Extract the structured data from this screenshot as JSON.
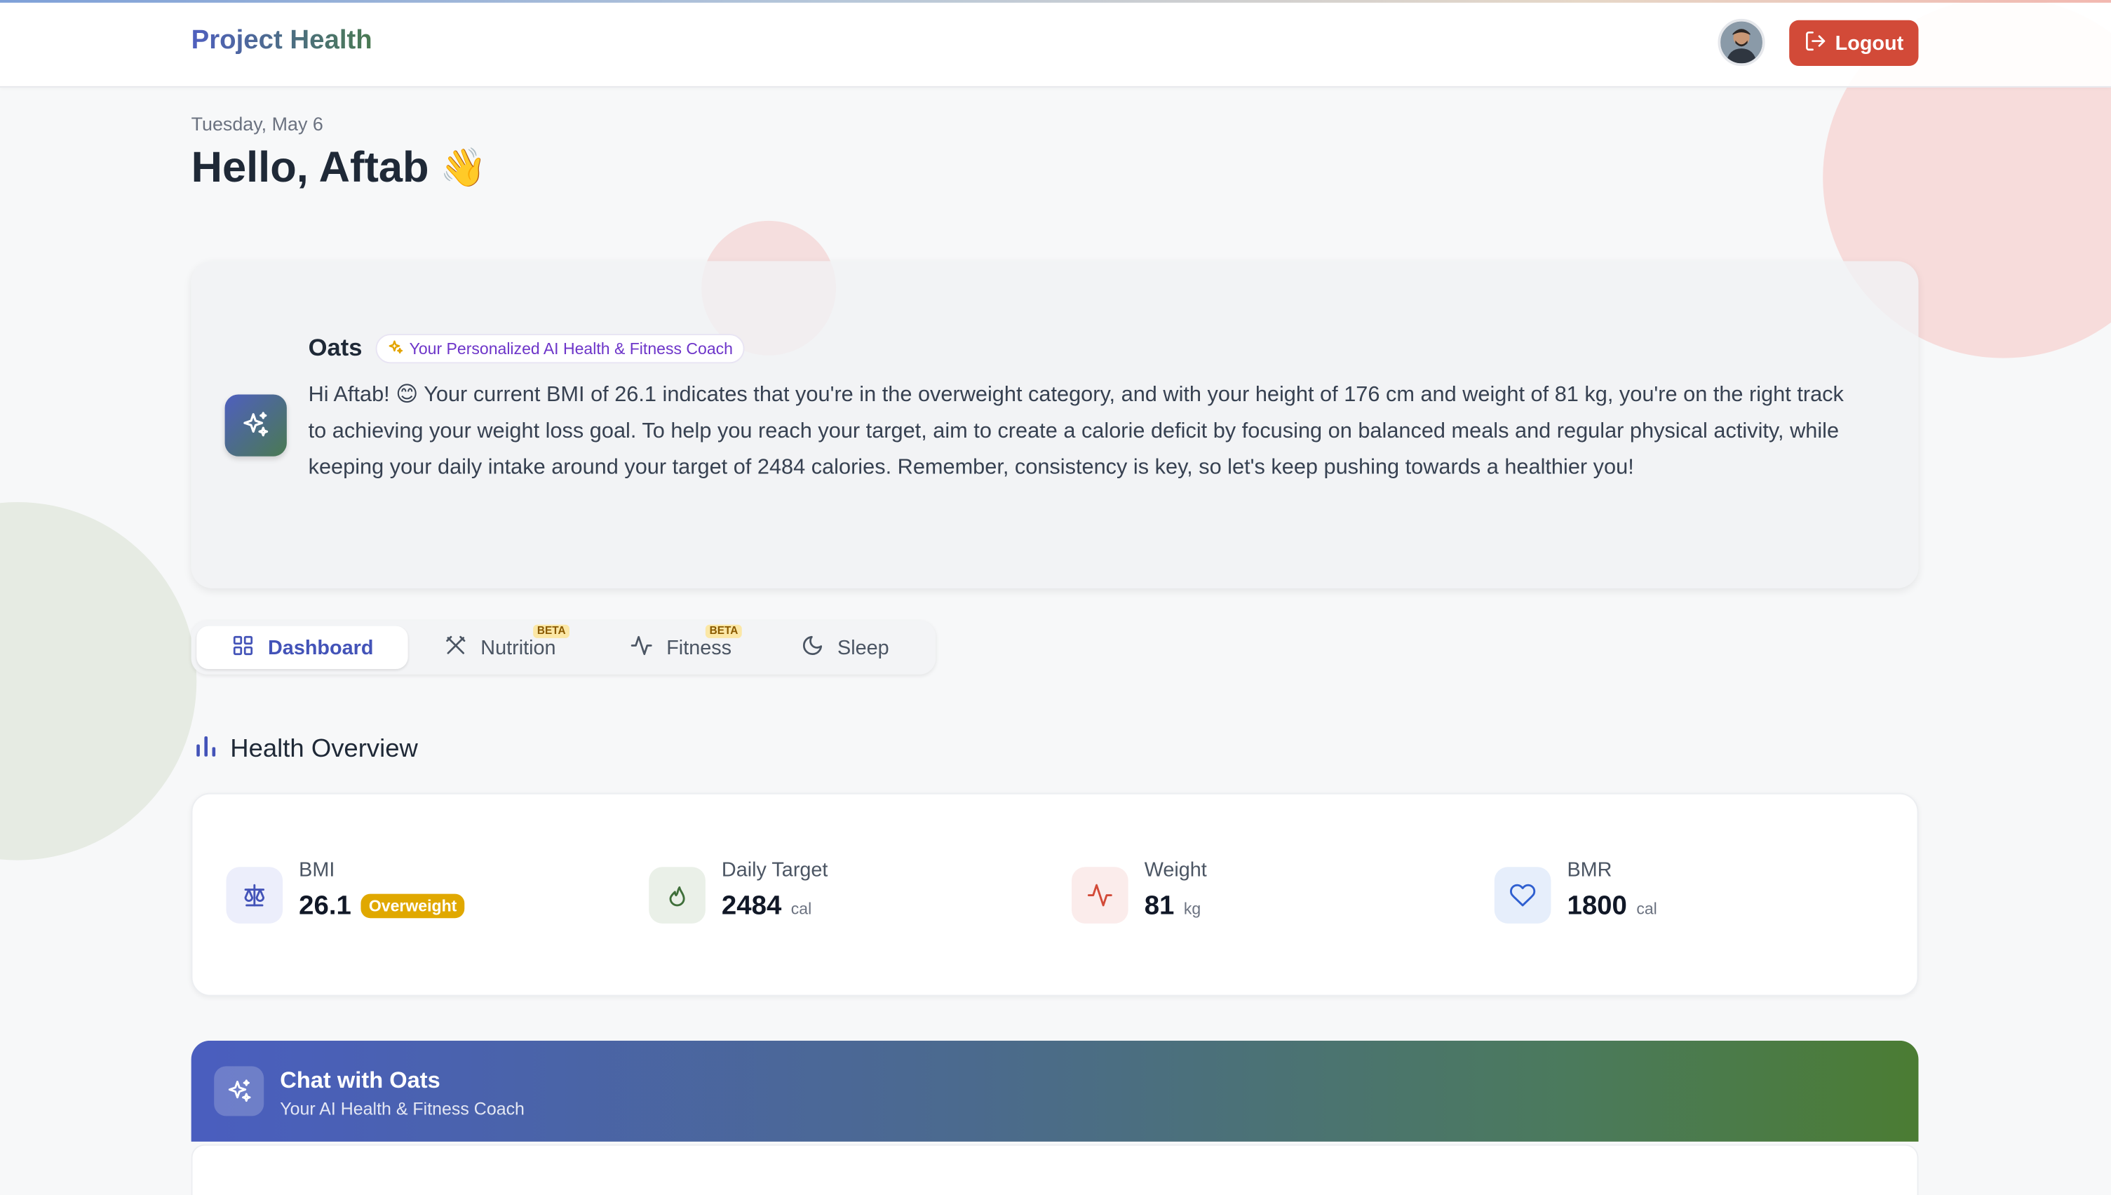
{
  "header": {
    "brand": "Project Health",
    "logout_label": "Logout",
    "avatar_alt": "User avatar"
  },
  "greeting": {
    "date": "Tuesday, May 6",
    "hello": "Hello, Aftab",
    "wave_emoji": "👋"
  },
  "oats": {
    "name": "Oats",
    "pill_label": "Your Personalized AI Health & Fitness Coach",
    "message": "Hi Aftab! 😊 Your current BMI of 26.1 indicates that you're in the overweight category, and with your height of 176 cm and weight of 81 kg, you're on the right track to achieving your weight loss goal. To help you reach your target, aim to create a calorie deficit by focusing on balanced meals and regular physical activity, while keeping your daily intake around your target of 2484 calories. Remember, consistency is key, so let's keep pushing towards a healthier you!"
  },
  "tabs": [
    {
      "label": "Dashboard",
      "icon": "grid-icon",
      "active": true,
      "beta": false
    },
    {
      "label": "Nutrition",
      "icon": "utensils-icon",
      "active": false,
      "beta": true,
      "beta_label": "BETA"
    },
    {
      "label": "Fitness",
      "icon": "activity-icon",
      "active": false,
      "beta": true,
      "beta_label": "BETA"
    },
    {
      "label": "Sleep",
      "icon": "moon-icon",
      "active": false,
      "beta": false
    }
  ],
  "overview": {
    "title": "Health Overview",
    "stats": [
      {
        "label": "BMI",
        "value": "26.1",
        "badge": "Overweight",
        "icon": "scale-icon"
      },
      {
        "label": "Daily Target",
        "value": "2484",
        "unit": "cal",
        "icon": "flame-icon"
      },
      {
        "label": "Weight",
        "value": "81",
        "unit": "kg",
        "icon": "pulse-icon"
      },
      {
        "label": "BMR",
        "value": "1800",
        "unit": "cal",
        "icon": "heart-icon"
      }
    ]
  },
  "chat": {
    "title": "Chat with Oats",
    "subtitle": "Your AI Health & Fitness Coach"
  },
  "colors": {
    "logout_bg": "#d24a38",
    "accent_blue": "#4353b8",
    "accent_green": "#4a7a52",
    "badge_overweight": "#e0a800"
  }
}
